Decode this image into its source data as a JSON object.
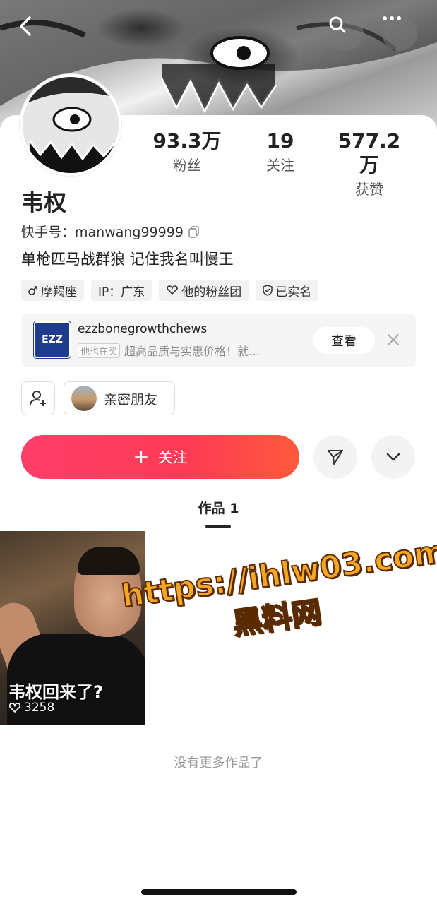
{
  "header": {
    "back_icon": "chevron-left-icon",
    "search_icon": "search-icon",
    "more_icon": "more-dots-icon"
  },
  "profile": {
    "name": "韦权",
    "kuaishou_id": "快手号：manwang99999",
    "bio": "单枪匹马战群狼 记住我名叫慢王",
    "stats": [
      {
        "value": "93.3万",
        "label": "粉丝"
      },
      {
        "value": "19",
        "label": "关注"
      },
      {
        "value": "577.2万",
        "label": "获赞"
      }
    ],
    "tags": [
      {
        "icon": "male-icon",
        "label": "摩羯座"
      },
      {
        "icon": "",
        "label": "IP：广东"
      },
      {
        "icon": "heart-badge-icon",
        "label": "他的粉丝团"
      },
      {
        "icon": "verified-shield-icon",
        "label": "已实名"
      }
    ]
  },
  "shop": {
    "logo_text": "EZZ",
    "name": "ezzbonegrowthchews",
    "pill": "他也在买",
    "subtitle": "超高品质与实惠价格！就…",
    "view_label": "查看"
  },
  "friends": {
    "label": "亲密朋友"
  },
  "actions": {
    "follow_label": "关注",
    "follow_plus": "+"
  },
  "tabs": {
    "works_label": "作品 1"
  },
  "videos": [
    {
      "title": "韦权回来了?",
      "likes": "3258"
    }
  ],
  "watermark": {
    "url": "https://ihlw03.com",
    "name": "黑料网"
  },
  "footer": {
    "no_more": "没有更多作品了"
  },
  "colors": {
    "accent": "#fe3b55",
    "accent_end": "#fe5a3b"
  }
}
